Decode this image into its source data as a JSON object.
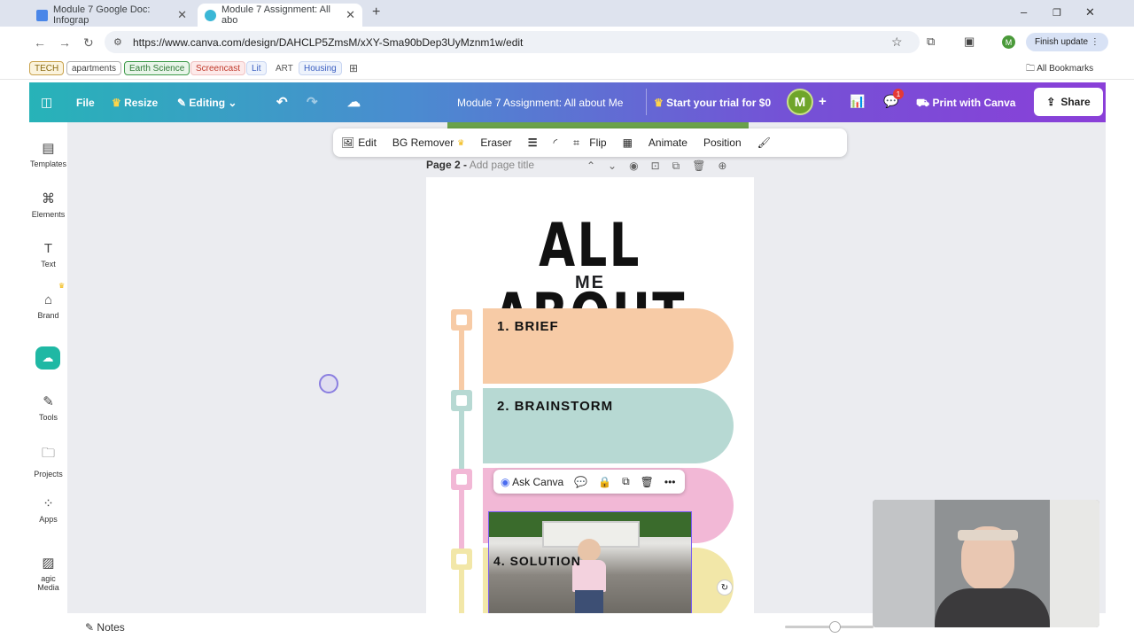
{
  "browser": {
    "tabs": [
      {
        "title": "Module 7 Google Doc: Infograp",
        "active": false
      },
      {
        "title": "Module 7 Assignment: All abo",
        "active": true
      }
    ],
    "url": "https://www.canva.com/design/DAHCLP5ZmsM/xXY-Sma90bDep3UyMznm1w/edit",
    "finish_update": "Finish update",
    "profile_initial": "M",
    "all_bookmarks": "All Bookmarks",
    "bookmarks": [
      "TECH",
      "apartments",
      "Earth Science",
      "Screencast",
      "Lit",
      "ART",
      "Housing"
    ]
  },
  "canva_header": {
    "file": "File",
    "resize": "Resize",
    "editing": "Editing",
    "doc_title": "Module 7 Assignment: All about Me",
    "trial": "Start your trial for $0",
    "avatar": "M",
    "notif_count": "1",
    "print": "Print with Canva",
    "share": "Share"
  },
  "sidebar": [
    {
      "label": "Templates",
      "icon": "templates-icon"
    },
    {
      "label": "Elements",
      "icon": "elements-icon"
    },
    {
      "label": "Text",
      "icon": "text-icon"
    },
    {
      "label": "Brand",
      "icon": "brand-icon"
    },
    {
      "label": "Tools",
      "icon": "tools-icon"
    },
    {
      "label": "Projects",
      "icon": "projects-icon"
    },
    {
      "label": "Apps",
      "icon": "apps-icon"
    },
    {
      "label": "agic Media",
      "icon": "magic-media-icon"
    }
  ],
  "toolbar": {
    "edit": "Edit",
    "bg_remover": "BG Remover",
    "eraser": "Eraser",
    "flip": "Flip",
    "animate": "Animate",
    "position": "Position"
  },
  "page": {
    "label": "Page 2 -",
    "title_placeholder": "Add page title",
    "heading": "ALL ABOUT",
    "subheading": "ME",
    "steps": [
      "1. BRIEF",
      "2. BRAINSTORM",
      "4. SOLUTION"
    ]
  },
  "ask_canva": "Ask Canva",
  "notes": "Notes",
  "colors": {
    "step1": "#f7cba6",
    "step2": "#b7d9d3",
    "step3": "#f2b8d6",
    "step4": "#f2e7a8"
  }
}
